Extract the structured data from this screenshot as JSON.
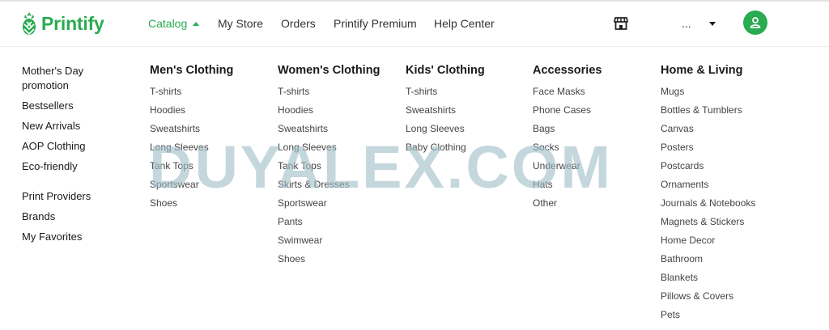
{
  "brand": {
    "name": "Printify",
    "color": "#29ab51"
  },
  "nav": {
    "catalog": "Catalog",
    "my_store": "My Store",
    "orders": "Orders",
    "premium": "Printify Premium",
    "help": "Help Center"
  },
  "header_right": {
    "store_icon": "store-icon",
    "account_label": "...",
    "profile_icon": "user-icon"
  },
  "sidebar": [
    "Mother's Day promotion",
    "Bestsellers",
    "New Arrivals",
    "AOP Clothing",
    "Eco-friendly",
    "Print Providers",
    "Brands",
    "My Favorites"
  ],
  "columns": [
    {
      "title": "Men's Clothing",
      "items": [
        "T-shirts",
        "Hoodies",
        "Sweatshirts",
        "Long Sleeves",
        "Tank Tops",
        "Sportswear",
        "Shoes"
      ]
    },
    {
      "title": "Women's Clothing",
      "items": [
        "T-shirts",
        "Hoodies",
        "Sweatshirts",
        "Long Sleeves",
        "Tank Tops",
        "Skirts & Dresses",
        "Sportswear",
        "Pants",
        "Swimwear",
        "Shoes"
      ]
    },
    {
      "title": "Kids' Clothing",
      "items": [
        "T-shirts",
        "Sweatshirts",
        "Long Sleeves",
        "Baby Clothing"
      ]
    },
    {
      "title": "Accessories",
      "items": [
        "Face Masks",
        "Phone Cases",
        "Bags",
        "Socks",
        "Underwear",
        "Hats",
        "Other"
      ]
    },
    {
      "title": "Home & Living",
      "items": [
        "Mugs",
        "Bottles & Tumblers",
        "Canvas",
        "Posters",
        "Postcards",
        "Ornaments",
        "Journals & Notebooks",
        "Magnets & Stickers",
        "Home Decor",
        "Bathroom",
        "Blankets",
        "Pillows & Covers",
        "Pets"
      ]
    }
  ],
  "watermark": "DUYALEX.COM"
}
